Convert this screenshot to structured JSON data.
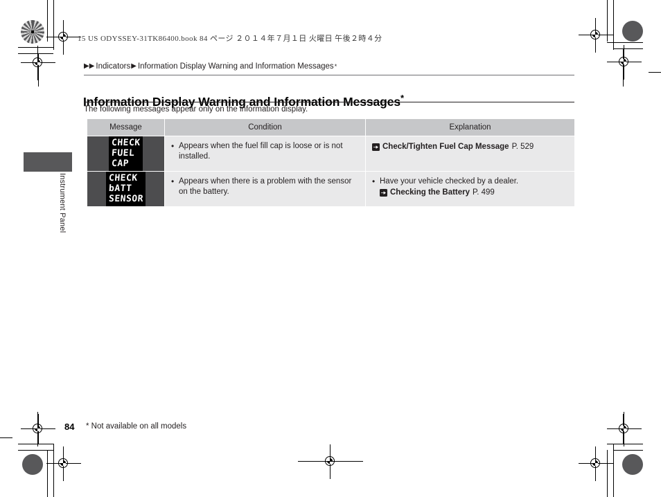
{
  "document": {
    "header_line": "15 US ODYSSEY-31TK86400.book   84 ページ   ２０１４年７月１日   火曜日   午後２時４分",
    "page_number": "84",
    "footnote": "* Not available on all models",
    "side_tab_label": "Instrument Panel"
  },
  "breadcrumb": {
    "arrow_double": "▶▶",
    "arrow_single": "▶",
    "level1": "Indicators",
    "level2": "Information Display Warning and Information Messages",
    "level2_asterisk": "*"
  },
  "page": {
    "title": "Information Display Warning and Information Messages",
    "title_asterisk": "*",
    "intro": "The following messages appear only on the information display."
  },
  "table": {
    "headers": [
      "Message",
      "Condition",
      "Explanation"
    ],
    "rows": [
      {
        "message_lines": [
          "CHECK",
          "FUEL",
          "CAP"
        ],
        "condition_bullet": "•",
        "condition": "Appears when the fuel fill cap is loose or is not installed.",
        "explanation_bullet": "",
        "explanation_text": "",
        "reference_title": "Check/Tighten Fuel Cap Message",
        "reference_page": "P. 529",
        "reference_icon": "jump-to-page-icon"
      },
      {
        "message_lines": [
          "CHECK",
          "bATT",
          "SENSOR"
        ],
        "condition_bullet": "•",
        "condition": "Appears when there is a problem with the sensor on the battery.",
        "explanation_bullet": "•",
        "explanation_text": "Have your vehicle checked by a dealer.",
        "reference_title": "Checking the Battery",
        "reference_page": "P. 499",
        "reference_icon": "jump-to-page-icon"
      }
    ]
  },
  "colors": {
    "header_fill": "#c6c7c9",
    "cell_fill": "#e9e9ea",
    "message_fill": "#4d4d4f",
    "lcd_bg": "#000000",
    "lcd_text": "#ffffff",
    "tab_fill": "#58585a"
  }
}
